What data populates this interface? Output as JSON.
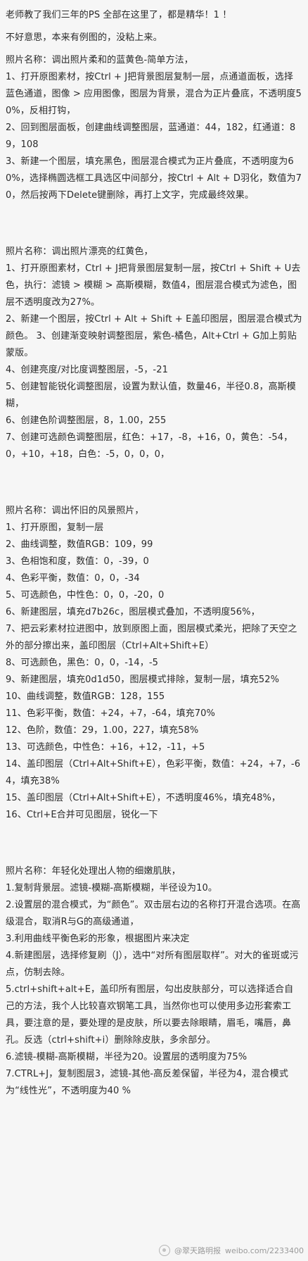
{
  "intro": {
    "title": "老师教了我们三年的PS 全部在这里了，都是精华！1 ！",
    "note": "不好意思，本来有例图的，没粘上来。"
  },
  "sections": [
    {
      "heading": "照片名称：调出照片柔和的蓝黄色-简单方法，",
      "paragraphs": [
        "1、打开原图素材，按Ctrl + J把背景图层复制一层，点通道面板，选择蓝色通道，图像 > 应用图像，图层为背景，混合为正片叠底，不透明度50%，反相打钩，",
        "2、回到图层面板，创建曲线调整图层，蓝通道：44，182，红通道：89，108",
        "3、新建一个图层，填充黑色，图层混合模式为正片叠底，不透明度为60%，选择椭圆选框工具选区中间部分，按Ctrl + Alt + D羽化，数值为70，然后按两下Delete键删除，再打上文字，完成最终效果。"
      ]
    },
    {
      "heading": "照片名称：调出照片漂亮的红黄色，",
      "paragraphs": [
        "1、打开原图素材，Ctrl + J把背景图层复制一层，按Ctrl + Shift + U去色，执行：滤镜 > 模糊 > 高斯模糊，数值4，图层混合模式为滤色，图层不透明度改为27%。",
        "2、新建一个图层，按Ctrl + Alt + Shift + E盖印图层，图层混合模式为颜色。 3、创建渐变映射调整图层，紫色-橘色，Alt+Ctrl + G加上剪贴蒙版。",
        "4、创建亮度/对比度调整图层，-5，-21",
        "5、创建智能锐化调整图层，设置为默认值，数量46，半径0.8，高斯模糊，",
        "6、创建色阶调整图层，8，1.00，255",
        "7、创建可选颜色调整图层，红色：+17，-8，+16，0，黄色：-54，0，+10，+18，白色：-5，0，0，0，"
      ]
    },
    {
      "heading": "照片名称：调出怀旧的风景照片，",
      "paragraphs": [
        "1、打开原图，复制一层",
        "2、曲线调整，数值RGB：109，99",
        "3、色相饱和度，数值：0，-39，0",
        "4、色彩平衡，数值：0，0，-34",
        "5、可选颜色，中性色：0，0，-20，0",
        "6、新建图层，填充d7b26c，图层模式叠加，不透明度56%，",
        "7、把云彩素材拉进图中，放到原图上面，图层模式柔光，把除了天空之外的部分擦出来，盖印图层（Ctrl+Alt+Shift+E）",
        "8、可选颜色，黑色：0，0，-14，-5",
        "9、新建图层，填充0d1d50，图层模式排除，复制一层，填充52%",
        "10、曲线调整，数值RGB：128，155",
        "11、色彩平衡，数值：+24，+7，-64，填充70%",
        "12、色阶，数值：29，1.00，227，填充58%",
        "13、可选颜色，中性色：+16，+12，-11，+5",
        "14、盖印图层（Ctrl+Alt+Shift+E），色彩平衡，数值：+24，+7，-64，填充38%",
        "15、盖印图层（Ctrl+Alt+Shift+E），不透明度46%，填充48%，",
        "16、Ctrl+E合并可见图层，锐化一下"
      ]
    },
    {
      "heading": "照片名称：年轻化处理出人物的细嫩肌肤，",
      "paragraphs": [
        "1.复制背景层。滤镜-模糊-高斯模糊，半径设为10。",
        "2.设置层的混合模式，为“颜色”。双击层右边的名称打开混合选项。在高级混合，取消R与G的高级通道，",
        "3.利用曲线平衡色彩的形象，根据图片来决定",
        "4.新建图层，选择修复刷（J），选中“对所有图层取样”。对大的雀斑或污点，仿制去除。",
        "5.ctrl+shift+alt+E，盖印所有图层，勾出皮肤部分，可以选择适合自己的方法，我个人比较喜欢钢笔工具，当然你也可以使用多边形套索工具，要注意的是，要处理的是皮肤，所以要去除眼睛，眉毛，嘴唇，鼻孔。反选（ctrl+shift+i）删除除皮肤，多余部分。",
        "6.滤镜-模糊-高斯模糊，半径为20。设置层的透明度为75%",
        "7.CTRL+J，复制图层3，滤镜-其他-高反差保留，半径为4，混合模式为“线性光”，不透明度为40 %"
      ]
    }
  ],
  "footer": {
    "source": "@翠天路明报",
    "site": "weibo.com/2233400"
  }
}
